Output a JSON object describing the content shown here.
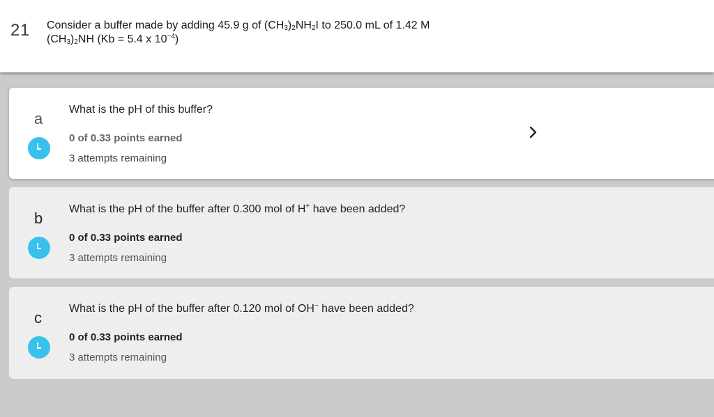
{
  "question": {
    "number": "21",
    "text_line1_a": "Consider a buffer made by adding 45.9 g of (CH",
    "sub1": "3",
    "text_line1_b": ")",
    "sub2": "2",
    "text_line1_c": "NH",
    "sub3": "2",
    "text_line1_d": "I to 250.0 mL of 1.42 M",
    "text_line2_a": "(CH",
    "sub4": "3",
    "text_line2_b": ")",
    "sub5": "2",
    "text_line2_c": "NH (Kb = 5.4 x 10",
    "sup1": "−4",
    "text_line2_d": ")"
  },
  "parts": [
    {
      "letter": "a",
      "prompt": "What is the pH of this buffer?",
      "prompt_sup": "",
      "prompt_tail": "",
      "points": "0 of 0.33 points earned",
      "attempts": "3 attempts remaining",
      "active": true
    },
    {
      "letter": "b",
      "prompt": "What is the pH of the buffer after 0.300 mol of H",
      "prompt_sup": "+",
      "prompt_tail": " have been added?",
      "points": "0 of 0.33 points earned",
      "attempts": "3 attempts remaining",
      "active": false
    },
    {
      "letter": "c",
      "prompt": "What is the pH of the buffer after 0.120 mol of OH",
      "prompt_sup": "−",
      "prompt_tail": " have been added?",
      "points": "0 of 0.33 points earned",
      "attempts": "3 attempts remaining",
      "active": false
    }
  ],
  "icons": {
    "status": "clock-icon",
    "expand": "chevron-right-icon"
  },
  "colors": {
    "status_dot": "#36c2ec",
    "page_background": "#cbcbcb",
    "inactive_part": "#eeeeee",
    "active_part": "#ffffff"
  }
}
